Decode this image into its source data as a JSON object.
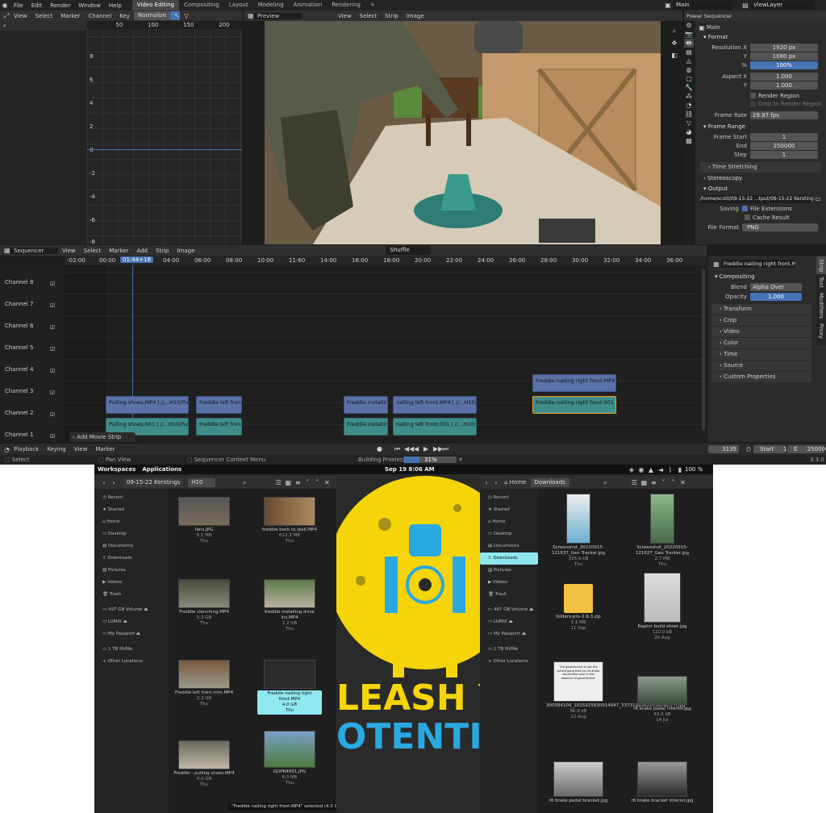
{
  "topbar": {
    "menus": [
      "File",
      "Edit",
      "Render",
      "Window",
      "Help"
    ],
    "workspaces": [
      "Video Editing",
      "Compositing",
      "Layout",
      "Modeling",
      "Animation",
      "Rendering"
    ],
    "scene": "Main",
    "view_layer": "ViewLayer"
  },
  "graph": {
    "menus": [
      "View",
      "Select",
      "Marker",
      "Channel",
      "Key"
    ],
    "normalize": "Normalize",
    "x_ticks": [
      "50",
      "100",
      "150",
      "200"
    ],
    "y_ticks": [
      "8",
      "6",
      "4",
      "2",
      "0",
      "-2",
      "-4",
      "-6",
      "-8"
    ]
  },
  "preview": {
    "title": "Preview",
    "menus": [
      "View",
      "Select",
      "Strip",
      "Image"
    ]
  },
  "properties_top": {
    "header": [
      "Power Sequencer",
      "Playback:",
      "Normal (1x)"
    ],
    "scene_name": "Main",
    "format_label": "Format",
    "resolution_x_label": "Resolution X",
    "resolution_x": "1920 px",
    "y_label": "Y",
    "resolution_y": "1080 px",
    "pct_label": "%",
    "resolution_pct": "100%",
    "aspect_x_label": "Aspect X",
    "aspect_x": "1.000",
    "aspect_y": "1.000",
    "render_region": "Render Region",
    "crop_region": "Crop to Render Region",
    "frame_rate_label": "Frame Rate",
    "frame_rate": "29.97 fps",
    "frame_range_label": "Frame Range",
    "frame_start_label": "Frame Start",
    "frame_start": "1",
    "end_label": "End",
    "frame_end": "250000",
    "step_label": "Step",
    "frame_step": "1",
    "time_stretching": "Time Stretching",
    "stereoscopy": "Stereoscopy",
    "output_label": "Output",
    "output_path": "/home/scott/09-15-22 ...tput/09-15-22 Kerstings",
    "saving_label": "Saving",
    "file_extensions": "File Extensions",
    "cache_result": "Cache Result",
    "file_format_label": "File Format",
    "file_format": "PNG"
  },
  "sequencer": {
    "title": "Sequencer",
    "menus": [
      "View",
      "Select",
      "Marker",
      "Add",
      "Strip",
      "Image"
    ],
    "shuffle": "Shuffle",
    "playhead": "01:44+18",
    "time_ticks": [
      "-02:00",
      "00:00",
      "02:00",
      "04:00",
      "06:00",
      "08:00",
      "10:00",
      "11:60",
      "14:00",
      "16:00",
      "18:00",
      "20:00",
      "22:00",
      "24:00",
      "26:00",
      "28:00",
      "30:00",
      "32:00",
      "34:00",
      "36:00"
    ],
    "channels": [
      "Channel 9",
      "Channel 8",
      "Channel 7",
      "Channel 6",
      "Channel 5",
      "Channel 4",
      "Channel 3",
      "Channel 2",
      "Channel 1"
    ],
    "strips": {
      "c3_a": "Freddie nailing right front.MP4 | //...",
      "c2_a": "Pulling shoes.MP4 | //...H10/Pulling",
      "c2_b": "Freddie left front t",
      "c2_c": "Freddie installing",
      "c2_d": "nailing left front.MP4 | //...H10/nail",
      "c2_e": "Freddie nailing right front.001 | //...",
      "c1_a": "Pulling shoes.001 | //...H10/Pulling",
      "c1_b": "Freddie left front t",
      "c1_c": "Freddie installing",
      "c1_d": "nailing left front.001 | //...H10/nailin"
    },
    "add_movie_strip": "Add Movie Strip"
  },
  "strip_props": {
    "strip_name": "Freddie nailing right front.MP4",
    "compositing": "Compositing",
    "blend_label": "Blend",
    "blend": "Alpha Over",
    "opacity_label": "Opacity",
    "opacity": "1.000",
    "sections": [
      "Transform",
      "Crop",
      "Video",
      "Color",
      "Time",
      "Source",
      "Custom Properties"
    ],
    "side_tabs": [
      "Strip",
      "Tool",
      "Modifiers",
      "Proxy"
    ]
  },
  "timeline": {
    "menus": [
      "Playback",
      "Keying",
      "View",
      "Marker"
    ],
    "current_frame": "3135",
    "start_label": "Start",
    "start": "1",
    "end_label": "E",
    "end": "250000"
  },
  "statusbar": {
    "select": "Select",
    "pan_view": "Pan View",
    "context_menu": "Sequencer Context Menu",
    "building": "Building Proxies",
    "progress_text": "31%",
    "progress": 0.31,
    "version": "3.3.0"
  },
  "gnome": {
    "workspaces": "Workspaces",
    "applications": "Applications",
    "clock": "Sep 19  8:06 AM",
    "battery": "100 %"
  },
  "nautilus_left": {
    "path_folder": "09-15-22 Kerstings",
    "path_sub": "H10",
    "sidebar": [
      "Recent",
      "Starred",
      "Home",
      "Desktop",
      "Documents",
      "Downloads",
      "Pictures",
      "Videos",
      "Trash",
      "497 GB Volume",
      "LUMIX",
      "My Passport",
      "1 TB NVMe",
      "Other Locations"
    ],
    "files": [
      {
        "name": "fans.JPG",
        "size": "8.1 MB",
        "date": "Thu"
      },
      {
        "name": "freddie back to stall.MP4",
        "size": "612.2 MB",
        "date": "Thu"
      },
      {
        "name": "Freddie clenching.MP4",
        "size": "5.3 GB",
        "date": "Thu"
      },
      {
        "name": "freddie installing drive ins.MP4",
        "size": "2.2 GB",
        "date": "Thu"
      },
      {
        "name": "Freddie left front trim.MP4",
        "size": "2.3 GB",
        "date": "Thu"
      },
      {
        "name": "Freddie nailing right front.MP4",
        "size": "4.0 GB",
        "date": "Thu"
      },
      {
        "name": "Freddie - pulling shoes.MP4",
        "size": "4.0 GB",
        "date": "Thu"
      },
      {
        "name": "GOPR4951.JPG",
        "size": "6.3 MB",
        "date": "Thu"
      }
    ],
    "status": "\"Freddie nailing right front.MP4\" selected (4.0 GB)"
  },
  "wallpaper": {
    "line1": "LEASH YO",
    "line2": "OTENTIA"
  },
  "nautilus_right": {
    "path_home": "Home",
    "path_folder": "Downloads",
    "sidebar": [
      "Recent",
      "Starred",
      "Home",
      "Desktop",
      "Documents",
      "Downloads",
      "Pictures",
      "Videos",
      "Trash",
      "497 GB Volume",
      "LUMIX",
      "My Passport",
      "1 TB NVMe",
      "Other Locations"
    ],
    "meme_text": "The government is just the armed gang that you're afraid would take over in the absence of government.",
    "files": [
      {
        "name": "Screenshot_20220915-121637_Geo Tracker.jpg",
        "size": "325.9 kB",
        "date": "Thu"
      },
      {
        "name": "Screenshot_20220915-121627_Geo Tracker.jpg",
        "size": "2.7 MB",
        "date": "Thu"
      },
      {
        "name": "folders-pro-2.8.3.zip",
        "size": "3.1 MB",
        "date": "11 Sep"
      },
      {
        "name": "Raptor build sheet.jpg",
        "size": "122.0 kB",
        "date": "25 Aug"
      },
      {
        "name": "300584104_1015925630914047_337319656510587625_n.jpg",
        "size": "56.9 kB",
        "date": "22 Aug"
      },
      {
        "name": "r6 brake pedal interior.jpg",
        "size": "43.0 kB",
        "date": "14 Jul"
      },
      {
        "name": "r6 brake pedal bracket.jpg",
        "size": "",
        "date": ""
      },
      {
        "name": "r6 brake bracket interior.jpg",
        "size": "",
        "date": ""
      }
    ]
  },
  "colors": {
    "accent": "#4772b3",
    "selection": "#8fe8f0",
    "wallpaper_yellow": "#f5d50a",
    "wallpaper_blue": "#2aa8e0"
  }
}
